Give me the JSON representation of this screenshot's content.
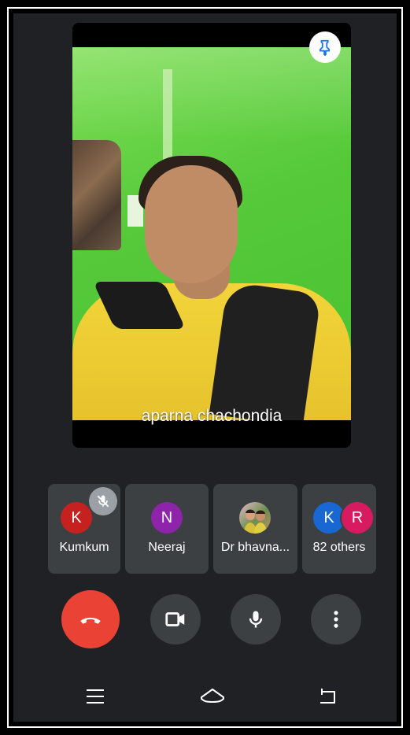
{
  "main_video": {
    "speaker_name": "aparna chachondia"
  },
  "participants": [
    {
      "name": "Kumkum",
      "initial": "K",
      "color": "#c5221f",
      "muted": true
    },
    {
      "name": "Neeraj",
      "initial": "N",
      "color": "#8e24aa"
    },
    {
      "name": "Dr bhavna...",
      "photo": true
    },
    {
      "name": "82 others",
      "initials": [
        "K",
        "R"
      ],
      "colors": [
        "#1967d2",
        "#d81b60"
      ]
    }
  ],
  "controls": {
    "end_call_color": "#ea4335",
    "icons": [
      "end-call-icon",
      "camera-icon",
      "microphone-icon",
      "more-options-icon"
    ]
  },
  "nav": {
    "icons": [
      "menu-icon",
      "home-icon",
      "back-icon"
    ]
  }
}
